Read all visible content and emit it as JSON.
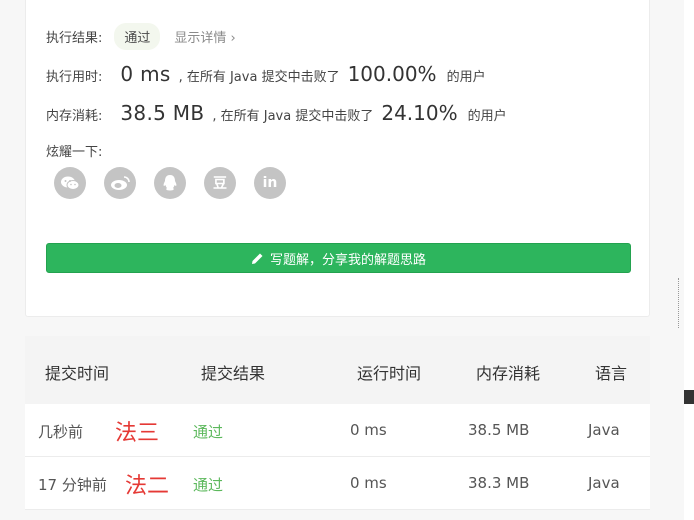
{
  "result": {
    "label": "执行结果:",
    "status": "通过",
    "details": "显示详情 ›"
  },
  "runtime": {
    "label": "执行用时:",
    "value": "0 ms",
    "text1": ", 在所有 Java 提交中击败了",
    "percent": "100.00%",
    "text2": "的用户"
  },
  "memory": {
    "label": "内存消耗:",
    "value": "38.5 MB",
    "text1": ", 在所有 Java 提交中击败了",
    "percent": "24.10%",
    "text2": "的用户"
  },
  "share": {
    "label": "炫耀一下:",
    "icons": [
      "wechat-icon",
      "weibo-icon",
      "qq-icon",
      "douban-icon",
      "linkedin-icon"
    ],
    "douban_glyph": "豆",
    "linkedin_glyph": "in"
  },
  "write_button": "写题解，分享我的解题思路",
  "table": {
    "headers": [
      "提交时间",
      "提交结果",
      "运行时间",
      "内存消耗",
      "语言"
    ],
    "rows": [
      {
        "time": "几秒前",
        "note": "法三",
        "result": "通过",
        "runtime": "0 ms",
        "memory": "38.5 MB",
        "lang": "Java"
      },
      {
        "time": "17 分钟前",
        "note": "法二",
        "result": "通过",
        "runtime": "0 ms",
        "memory": "38.3 MB",
        "lang": "Java"
      }
    ]
  }
}
